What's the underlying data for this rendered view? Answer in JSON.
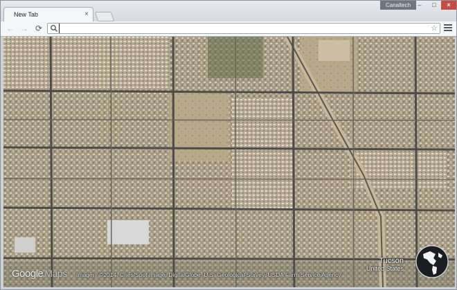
{
  "tab": {
    "title": "New Tab",
    "close_glyph": "×"
  },
  "profile": {
    "name": "Canaltech"
  },
  "window_controls": {
    "minimize": "–",
    "maximize": "□",
    "close": "×"
  },
  "toolbar": {
    "back_icon": "←",
    "forward_icon": "→",
    "reload_icon": "⟳",
    "omnibox_value": "",
    "star_icon": "☆"
  },
  "map": {
    "logo_google": "Google",
    "logo_maps": "Maps",
    "attribution": "Imagery ©2014, Cnes/Spot Image, DigitalGlobe, U.S. Geological Survey, USDA Farm Service Agency",
    "city": "Tucson",
    "country": "United States"
  },
  "colors": {
    "accent_close": "#c74b40",
    "profile_bg": "#6e7680"
  }
}
